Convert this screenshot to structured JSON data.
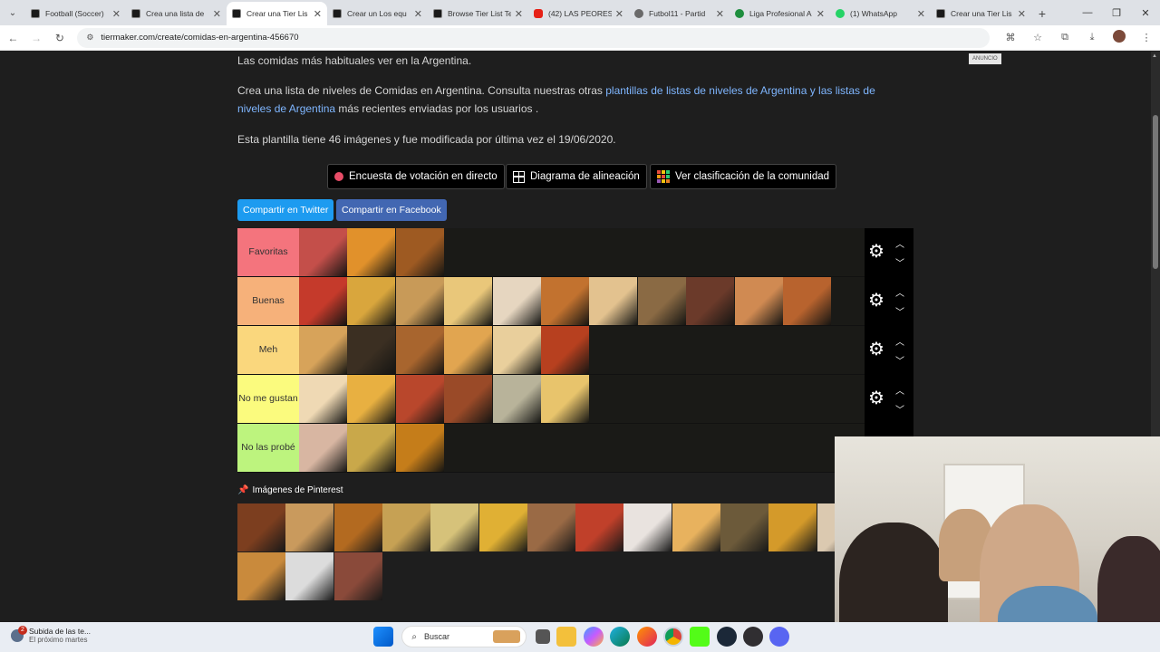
{
  "browser": {
    "tabs": [
      {
        "label": "Football (Soccer)",
        "icon": "tm"
      },
      {
        "label": "Crea una lista de",
        "icon": "tm"
      },
      {
        "label": "Crear una Tier Lis",
        "icon": "tm",
        "active": true
      },
      {
        "label": "Crear un Los equ",
        "icon": "tm"
      },
      {
        "label": "Browse Tier List Te",
        "icon": "tm"
      },
      {
        "label": "(42) LAS PEORES",
        "icon": "yt"
      },
      {
        "label": "Futbol11 - Partid",
        "icon": "g"
      },
      {
        "label": "Liga Profesional A",
        "icon": "green"
      },
      {
        "label": "(1) WhatsApp",
        "icon": "wa"
      },
      {
        "label": "Crear una Tier Lis",
        "icon": "tm"
      }
    ],
    "url": "tiermaker.com/create/comidas-en-argentina-456670"
  },
  "page": {
    "line1": "Las comidas más habituales ver en la Argentina.",
    "line2_pre": "Crea una lista de niveles de Comidas en Argentina. Consulta nuestras otras ",
    "line2_link": "plantillas de listas de niveles de Argentina y las listas de niveles de Argentina",
    "line2_post": " más recientes enviadas por los usuarios .",
    "line3": "Esta plantilla tiene 46 imágenes y fue modificada por última vez el 19/06/2020.",
    "ad_label": "ANUNCIO"
  },
  "modes": {
    "live": "Encuesta de votación en directo",
    "align": "Diagrama de alineación",
    "community": "Ver clasificación de la comunidad"
  },
  "share": {
    "twitter": "Compartir en Twitter",
    "facebook": "Compartir en Facebook"
  },
  "tiers": [
    {
      "label": "Favoritas",
      "color": "#f4747d",
      "items": [
        "#c44f4a",
        "#e1912b",
        "#9e5a22"
      ]
    },
    {
      "label": "Buenas",
      "color": "#f6b17a",
      "items": [
        "#c53a2b",
        "#d9a63d",
        "#c89a58",
        "#e9c77a",
        "#e6d6c0",
        "#c2722f",
        "#e3c28f",
        "#8a6a44",
        "#6b3a2a",
        "#d08a52",
        "#b8632e"
      ]
    },
    {
      "label": "Meh",
      "color": "#fad77d",
      "items": [
        "#d7a35a",
        "#3b2f22",
        "#a8652e",
        "#e1a550",
        "#e9cf9c",
        "#b7401f"
      ]
    },
    {
      "label": "No me gustan",
      "color": "#fbfb7e",
      "items": [
        "#efd9b4",
        "#e8b041",
        "#b9472c",
        "#9a4a28",
        "#b8b39a",
        "#e8c46c"
      ]
    },
    {
      "label": "No las probé",
      "color": "#bdf47e",
      "items": [
        "#d8b6a2",
        "#c9a84a",
        "#c57d1a"
      ]
    }
  ],
  "pool": {
    "title": "Imágenes de Pinterest",
    "items": [
      "#7c3e1f",
      "#c99a5d",
      "#b36a20",
      "#c6a154",
      "#d6c27a",
      "#e0b034",
      "#9a6a45",
      "#c0402a",
      "#e9e3df",
      "#e8b25e",
      "#6c5a3a",
      "#d49a2a",
      "#dbc9b0",
      "#c98a3c",
      "#dcdcdc",
      "#8a4a3a"
    ]
  },
  "taskbar": {
    "notif_title": "Subida de las te...",
    "notif_sub": "El próximo martes",
    "notif_badge": "2",
    "search": "Buscar"
  }
}
